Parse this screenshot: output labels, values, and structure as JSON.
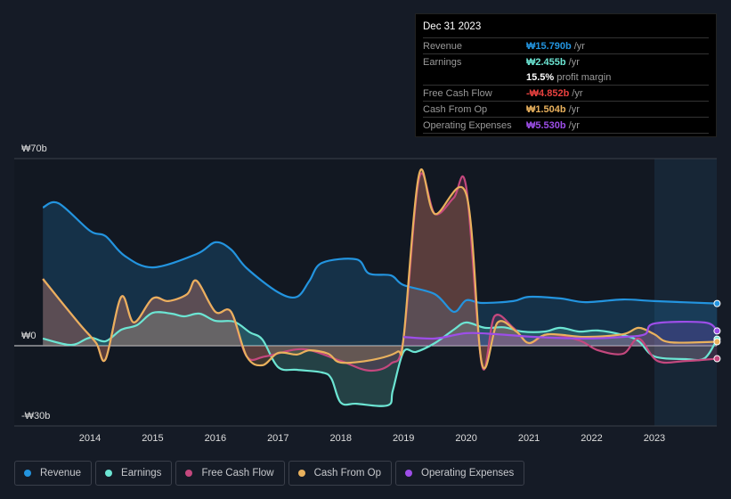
{
  "tooltip": {
    "date": "Dec 31 2023",
    "rows": [
      {
        "label": "Revenue",
        "value": "₩15.790b",
        "unit": "/yr",
        "color": "#2394df"
      },
      {
        "label": "Earnings",
        "value": "₩2.455b",
        "unit": "/yr",
        "color": "#6ce5d3"
      },
      {
        "label": "",
        "value": "15.5%",
        "unit": "profit margin",
        "color": "#ffffff"
      },
      {
        "label": "Free Cash Flow",
        "value": "-₩4.852b",
        "unit": "/yr",
        "color": "#e8413f"
      },
      {
        "label": "Cash From Op",
        "value": "₩1.504b",
        "unit": "/yr",
        "color": "#e9b15d"
      },
      {
        "label": "Operating Expenses",
        "value": "₩5.530b",
        "unit": "/yr",
        "color": "#9d4ee8"
      }
    ]
  },
  "legend": [
    {
      "label": "Revenue",
      "color": "#2394df"
    },
    {
      "label": "Earnings",
      "color": "#6ce5d3"
    },
    {
      "label": "Free Cash Flow",
      "color": "#c4487e"
    },
    {
      "label": "Cash From Op",
      "color": "#e9b15d"
    },
    {
      "label": "Operating Expenses",
      "color": "#9d4ee8"
    }
  ],
  "chart_data": {
    "type": "area",
    "ylabel_ticks": [
      "₩70b",
      "₩0",
      "-₩30b"
    ],
    "yticks": [
      70,
      0,
      -30
    ],
    "ylim": [
      -30,
      70
    ],
    "xlim": [
      2013.25,
      2024
    ],
    "xticks": [
      "2014",
      "2015",
      "2016",
      "2017",
      "2018",
      "2019",
      "2020",
      "2021",
      "2022",
      "2023"
    ],
    "highlight_from": 2023,
    "series": [
      {
        "name": "Revenue",
        "color": "#2394df",
        "points": [
          [
            2013.25,
            51.7
          ],
          [
            2013.5,
            53.3
          ],
          [
            2014,
            43
          ],
          [
            2014.25,
            41
          ],
          [
            2014.55,
            33.7
          ],
          [
            2015,
            29.3
          ],
          [
            2015.7,
            34.3
          ],
          [
            2016,
            38.7
          ],
          [
            2016.25,
            36
          ],
          [
            2016.5,
            29
          ],
          [
            2017,
            20
          ],
          [
            2017.3,
            18.3
          ],
          [
            2017.5,
            24.3
          ],
          [
            2017.7,
            31
          ],
          [
            2018.25,
            32.3
          ],
          [
            2018.45,
            27
          ],
          [
            2018.8,
            26.3
          ],
          [
            2019,
            22.7
          ],
          [
            2019.5,
            19.3
          ],
          [
            2019.8,
            12.7
          ],
          [
            2020,
            17
          ],
          [
            2020.25,
            16
          ],
          [
            2020.75,
            16.7
          ],
          [
            2021,
            18.3
          ],
          [
            2021.5,
            17.7
          ],
          [
            2021.9,
            16.3
          ],
          [
            2022.5,
            17.3
          ],
          [
            2023,
            16.7
          ],
          [
            2024,
            15.79
          ]
        ]
      },
      {
        "name": "Earnings",
        "color": "#6ce5d3",
        "points": [
          [
            2013.25,
            2.7
          ],
          [
            2013.7,
            0.3
          ],
          [
            2014,
            3
          ],
          [
            2014.25,
            1.7
          ],
          [
            2014.5,
            6
          ],
          [
            2014.75,
            7.7
          ],
          [
            2015,
            12.3
          ],
          [
            2015.3,
            12
          ],
          [
            2015.5,
            11
          ],
          [
            2015.75,
            12
          ],
          [
            2016,
            9.3
          ],
          [
            2016.3,
            9
          ],
          [
            2016.55,
            5
          ],
          [
            2016.75,
            2.3
          ],
          [
            2017,
            -8
          ],
          [
            2017.3,
            -9
          ],
          [
            2017.7,
            -10
          ],
          [
            2017.85,
            -12.3
          ],
          [
            2018,
            -21.3
          ],
          [
            2018.25,
            -21.7
          ],
          [
            2018.75,
            -22.3
          ],
          [
            2018.83,
            -16.7
          ],
          [
            2019,
            -2.3
          ],
          [
            2019.2,
            -2.3
          ],
          [
            2019.5,
            1
          ],
          [
            2019.8,
            6
          ],
          [
            2020,
            8.7
          ],
          [
            2020.3,
            6.7
          ],
          [
            2020.6,
            6.9
          ],
          [
            2020.9,
            5.3
          ],
          [
            2021.25,
            5.3
          ],
          [
            2021.5,
            6.7
          ],
          [
            2021.8,
            5.3
          ],
          [
            2022.1,
            5.7
          ],
          [
            2022.5,
            4
          ],
          [
            2022.75,
            1.7
          ],
          [
            2023,
            -4
          ],
          [
            2023.5,
            -5
          ],
          [
            2023.8,
            -4.7
          ],
          [
            2024,
            2.455
          ]
        ]
      },
      {
        "name": "Free Cash Flow",
        "color": "#c4487e",
        "points": [
          [
            2013.25,
            25
          ],
          [
            2013.5,
            17.7
          ],
          [
            2013.85,
            7.7
          ],
          [
            2014.1,
            1
          ],
          [
            2014.25,
            -5
          ],
          [
            2014.5,
            18.3
          ],
          [
            2014.7,
            8.7
          ],
          [
            2015,
            17.7
          ],
          [
            2015.25,
            16.7
          ],
          [
            2015.55,
            19.3
          ],
          [
            2015.7,
            24.3
          ],
          [
            2016,
            12.7
          ],
          [
            2016.25,
            12.7
          ],
          [
            2016.5,
            -4
          ],
          [
            2016.8,
            -4
          ],
          [
            2017.4,
            -1.3
          ],
          [
            2018,
            -5.7
          ],
          [
            2018.45,
            -9.3
          ],
          [
            2018.8,
            -6.7
          ],
          [
            2019,
            2.7
          ],
          [
            2019.25,
            62.7
          ],
          [
            2019.5,
            49.3
          ],
          [
            2019.8,
            55.3
          ],
          [
            2020,
            59.3
          ],
          [
            2020.25,
            -7.3
          ],
          [
            2020.45,
            11
          ],
          [
            2020.75,
            6.7
          ],
          [
            2021,
            1
          ],
          [
            2021.3,
            4.3
          ],
          [
            2021.8,
            2
          ],
          [
            2022.1,
            -1.7
          ],
          [
            2022.5,
            -3
          ],
          [
            2022.75,
            2.7
          ],
          [
            2023.05,
            -5.7
          ],
          [
            2023.5,
            -5.7
          ],
          [
            2024,
            -4.852
          ]
        ]
      },
      {
        "name": "Cash From Op",
        "color": "#e9b15d",
        "points": [
          [
            2013.25,
            25
          ],
          [
            2013.5,
            17.7
          ],
          [
            2013.85,
            7.7
          ],
          [
            2014.1,
            1
          ],
          [
            2014.25,
            -5
          ],
          [
            2014.5,
            18.3
          ],
          [
            2014.7,
            8.7
          ],
          [
            2015,
            17.7
          ],
          [
            2015.25,
            16.7
          ],
          [
            2015.55,
            19.3
          ],
          [
            2015.7,
            24.3
          ],
          [
            2016,
            12.7
          ],
          [
            2016.25,
            12.7
          ],
          [
            2016.5,
            -4
          ],
          [
            2016.75,
            -7.3
          ],
          [
            2017,
            -2.7
          ],
          [
            2017.3,
            -3.3
          ],
          [
            2017.5,
            -1.7
          ],
          [
            2017.8,
            -3
          ],
          [
            2018,
            -6.3
          ],
          [
            2018.5,
            -5.3
          ],
          [
            2018.9,
            -2.3
          ],
          [
            2019,
            2.7
          ],
          [
            2019.25,
            64.3
          ],
          [
            2019.5,
            49.3
          ],
          [
            2020,
            56.7
          ],
          [
            2020.25,
            -6.7
          ],
          [
            2020.5,
            8.7
          ],
          [
            2020.8,
            5.3
          ],
          [
            2021,
            1
          ],
          [
            2021.3,
            4.3
          ],
          [
            2021.9,
            3.3
          ],
          [
            2022.5,
            4.3
          ],
          [
            2022.75,
            6.7
          ],
          [
            2023,
            4.3
          ],
          [
            2023.25,
            1.3
          ],
          [
            2024,
            1.504
          ]
        ]
      },
      {
        "name": "Operating Expenses",
        "color": "#9d4ee8",
        "points": [
          [
            2019,
            3.3
          ],
          [
            2019.5,
            2.7
          ],
          [
            2020,
            4.7
          ],
          [
            2020.5,
            4.3
          ],
          [
            2021.1,
            3.3
          ],
          [
            2021.9,
            2.7
          ],
          [
            2022.5,
            3.3
          ],
          [
            2022.85,
            4.3
          ],
          [
            2023,
            8.3
          ],
          [
            2023.8,
            8.7
          ],
          [
            2024,
            5.53
          ]
        ]
      }
    ]
  }
}
